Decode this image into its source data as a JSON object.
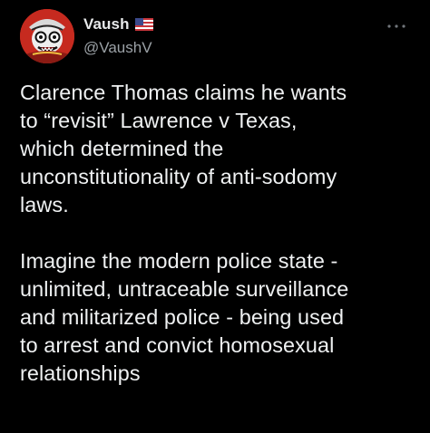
{
  "tweet": {
    "author": {
      "display_name": "Vaush",
      "handle": "@VaushV",
      "flag_icon": "us-flag-icon",
      "avatar_icon": "cartoon-avatar-icon"
    },
    "more_icon": "ellipsis-icon",
    "paragraphs": [
      [
        "Clarence Thomas claims he wants",
        "to “revisit” Lawrence v Texas,",
        "which determined the",
        "unconstitutionality of anti-sodomy",
        "laws."
      ],
      [
        "Imagine the modern police state -",
        "unlimited, untraceable surveillance",
        "and militarized police - being used",
        "to arrest and convict homosexual",
        "relationships"
      ]
    ]
  },
  "colors": {
    "background": "#000000",
    "text_primary": "#e7e9ea",
    "text_secondary": "#9ba1a6",
    "avatar_red": "#c8281e"
  }
}
